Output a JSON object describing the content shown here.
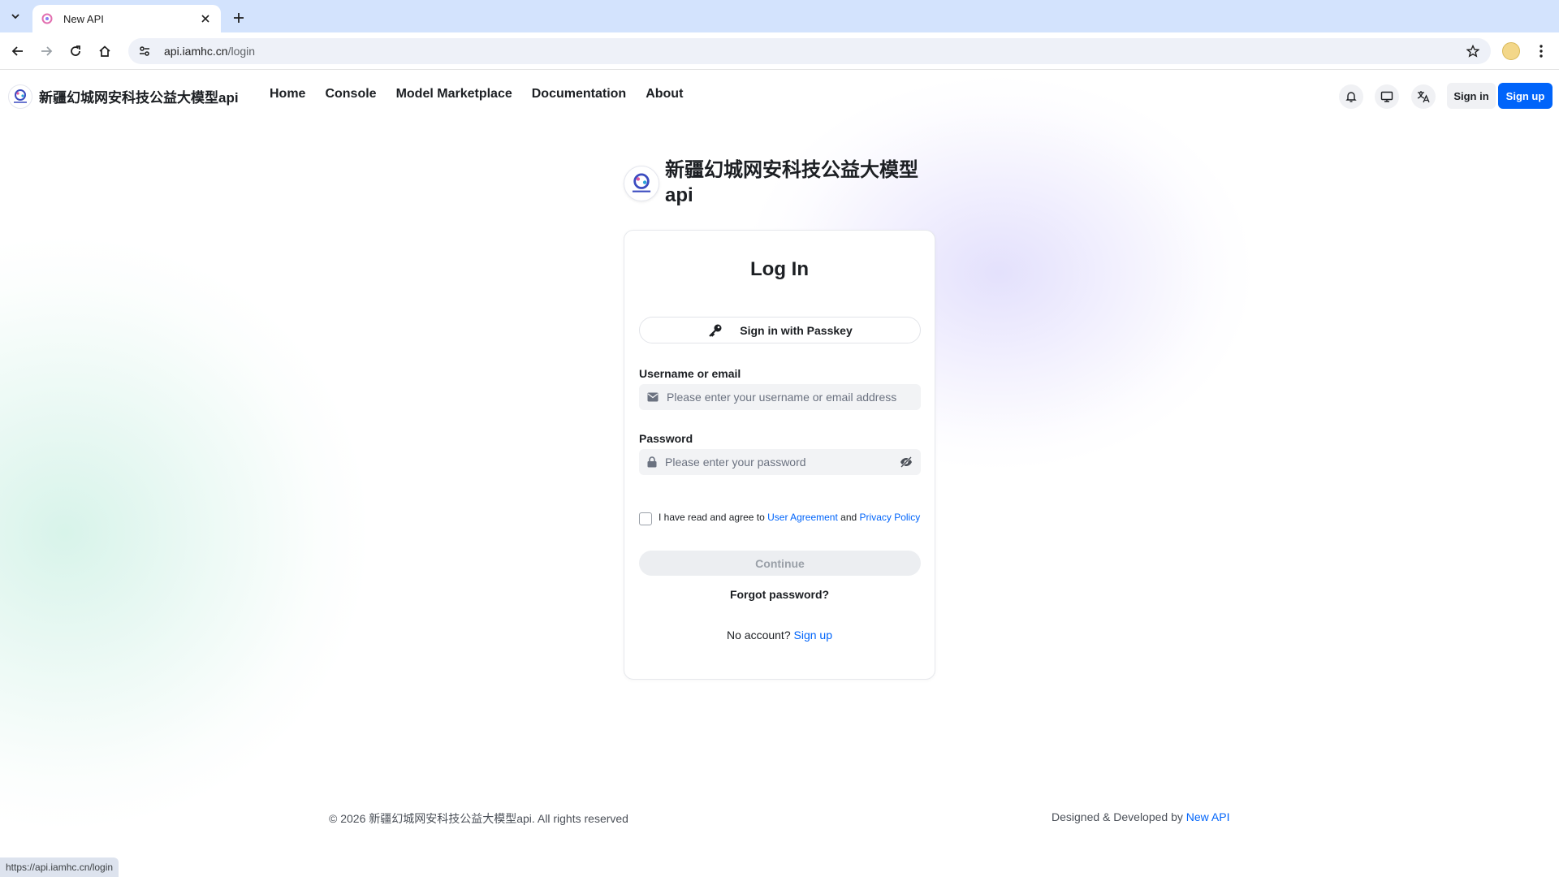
{
  "browser": {
    "tab_title": "New API",
    "url_host": "api.iamhc.cn",
    "url_path": "/login",
    "status_url": "https://api.iamhc.cn/login"
  },
  "site": {
    "name": "新疆幻城网安科技公益大模型api",
    "nav": [
      {
        "label": "Home"
      },
      {
        "label": "Console"
      },
      {
        "label": "Model Marketplace"
      },
      {
        "label": "Documentation"
      },
      {
        "label": "About"
      }
    ],
    "signin_label": "Sign in",
    "signup_label": "Sign up"
  },
  "hero": {
    "title": "新疆幻城网安科技公益大模型api"
  },
  "login": {
    "title": "Log In",
    "passkey_label": "Sign in with Passkey",
    "username_label": "Username or email",
    "username_placeholder": "Please enter your username or email address",
    "password_label": "Password",
    "password_placeholder": "Please enter your password",
    "agree_prefix": "I have read and agree to ",
    "agree_user_agreement": "User Agreement",
    "agree_and": " and ",
    "agree_privacy": "Privacy Policy",
    "continue_label": "Continue",
    "forgot_label": "Forgot password?",
    "no_account": "No account? ",
    "signup_link": "Sign up"
  },
  "footer": {
    "copyright": "© 2026 新疆幻城网安科技公益大模型api. All rights reserved",
    "designed_by": "Designed & Developed by ",
    "designed_link": "New API"
  },
  "colors": {
    "primary": "#0064fa",
    "tabstrip": "#d3e3fd",
    "input_bg": "#f2f3f5"
  },
  "icons": [
    "tab-search-icon",
    "favicon-icon",
    "close-icon",
    "plus-icon",
    "back-icon",
    "forward-icon",
    "reload-icon",
    "home-icon",
    "site-settings-icon",
    "star-icon",
    "kebab-menu-icon",
    "bell-icon",
    "monitor-icon",
    "translate-icon",
    "key-icon",
    "mail-icon",
    "lock-icon",
    "eye-off-icon"
  ]
}
